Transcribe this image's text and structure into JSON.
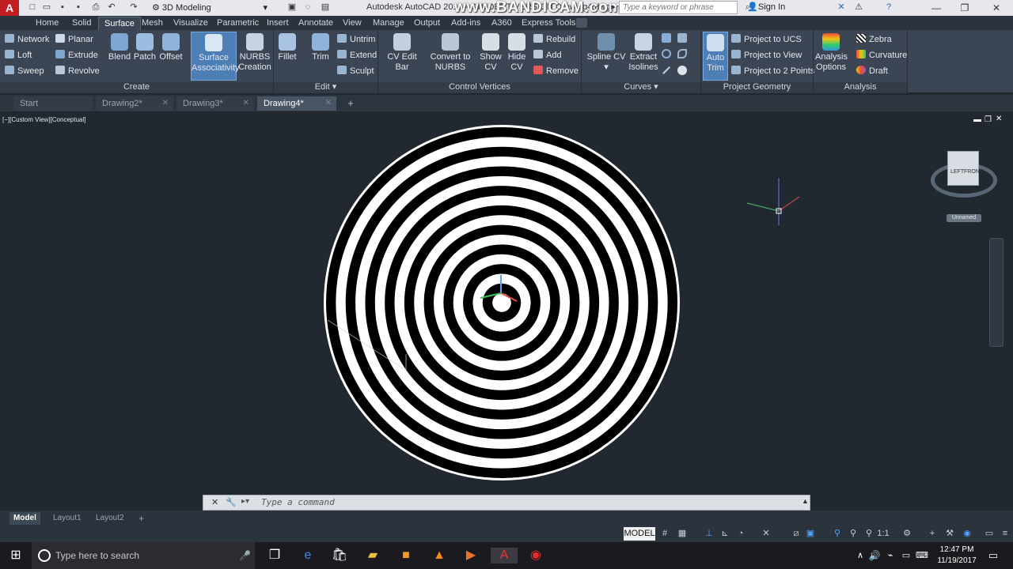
{
  "titlebar": {
    "workspace": "3D Modeling",
    "app_title": "Autodesk AutoCAD 2016 - STUDENT VERSION    Drawing4.dwg",
    "watermark": "www.BANDICAM.com",
    "search_placeholder": "Type a keyword or phrase",
    "sign_in": "Sign In"
  },
  "ribbon_tabs": [
    "Home",
    "Solid",
    "Surface",
    "Mesh",
    "Visualize",
    "Parametric",
    "Insert",
    "Annotate",
    "View",
    "Manage",
    "Output",
    "Add-ins",
    "A360",
    "Express Tools"
  ],
  "ribbon": {
    "create": {
      "title": "Create",
      "small_left": [
        "Network",
        "Loft",
        "Sweep"
      ],
      "small_right": [
        "Planar",
        "Extrude",
        "Revolve"
      ],
      "large": [
        "Blend",
        "Patch",
        "Offset"
      ],
      "surface_assoc": [
        "Surface",
        "Associativity"
      ],
      "nurbs": [
        "NURBS",
        "Creation"
      ]
    },
    "edit": {
      "title": "Edit",
      "fillet": "Fillet",
      "trim": "Trim",
      "small": [
        "Untrim",
        "Extend",
        "Sculpt"
      ]
    },
    "control_vertices": {
      "title": "Control Vertices",
      "cv_edit_bar": "CV Edit Bar",
      "convert": [
        "Convert to",
        "NURBS"
      ],
      "show_cv": [
        "Show",
        "CV"
      ],
      "hide_cv": [
        "Hide",
        "CV"
      ],
      "small": [
        "Rebuild",
        "Add",
        "Remove"
      ]
    },
    "curves": {
      "title": "Curves",
      "spline": "Spline CV",
      "extract": [
        "Extract",
        "Isolines"
      ]
    },
    "project_geometry": {
      "title": "Project Geometry",
      "auto_trim": [
        "Auto",
        "Trim"
      ],
      "small": [
        "Project to UCS",
        "Project to View",
        "Project to 2 Points"
      ]
    },
    "analysis": {
      "title": "Analysis",
      "options": [
        "Analysis",
        "Options"
      ],
      "small": [
        "Zebra",
        "Curvature",
        "Draft"
      ]
    }
  },
  "file_tabs": [
    "Start",
    "Drawing2*",
    "Drawing3*",
    "Drawing4*"
  ],
  "viewport": {
    "label": "[−][Custom View][Conceptual]",
    "viewcube_left": "LEFT",
    "viewcube_front": "FRONT",
    "ucs_name": "Unnamed",
    "rings": 9
  },
  "command": {
    "placeholder": "Type a command"
  },
  "layout_tabs": [
    "Model",
    "Layout1",
    "Layout2"
  ],
  "status": {
    "model": "MODEL",
    "scale": "1:1"
  },
  "taskbar": {
    "search_placeholder": "Type here to search",
    "time": "12:47 PM",
    "date": "11/19/2017"
  },
  "colors": {
    "accent": "#4d7eb5",
    "ribbon_bg": "#3b4553",
    "canvas_bg": "#212830"
  }
}
